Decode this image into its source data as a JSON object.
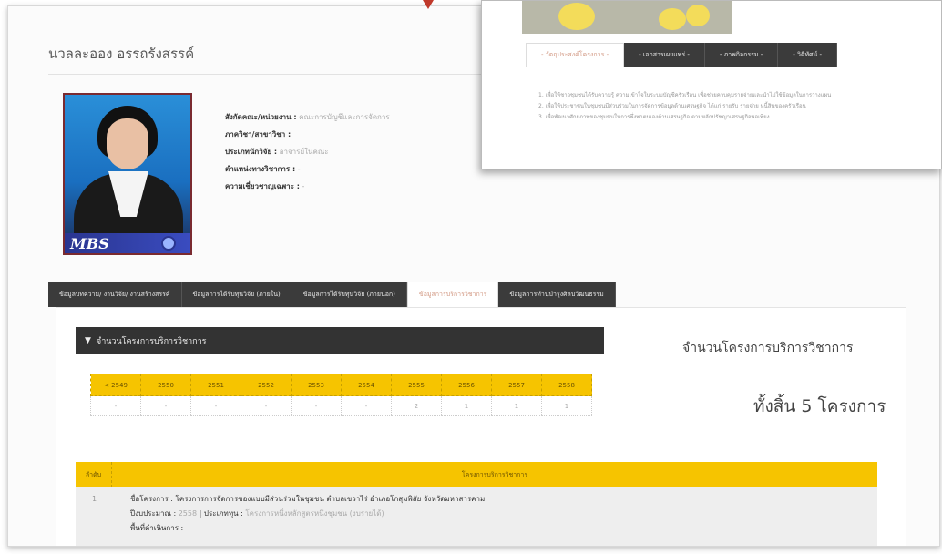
{
  "profile": {
    "name": "นวลละออง อรรถรังสรรค์",
    "fields": [
      {
        "label": "สังกัดคณะ/หน่วยงาน :",
        "value": "คณะการบัญชีและการจัดการ"
      },
      {
        "label": "ภาควิชา/สาขาวิชา :",
        "value": ""
      },
      {
        "label": "ประเภทนักวิจัย :",
        "value": "อาจารย์ในคณะ"
      },
      {
        "label": "ตำแหน่งทางวิชาการ :",
        "value": "-"
      },
      {
        "label": "ความเชี่ยวชาญเฉพาะ :",
        "value": "-"
      }
    ],
    "photo_label": "MBS"
  },
  "tabs": [
    {
      "label": "ข้อมูลบทความ/ งานวิจัย/ งานสร้างสรรค์",
      "active": false
    },
    {
      "label": "ข้อมูลการได้รับทุนวิจัย (ภายใน)",
      "active": false
    },
    {
      "label": "ข้อมูลการได้รับทุนวิจัย (ภายนอก)",
      "active": false
    },
    {
      "label": "ข้อมูลการบริการวิชาการ",
      "active": true
    },
    {
      "label": "ข้อมูลการทำนุบำรุงศิลปวัฒนธรรม",
      "active": false
    }
  ],
  "count_section": {
    "header": "จำนวนโครงการบริการวิชาการ",
    "years": [
      "< 2549",
      "2550",
      "2551",
      "2552",
      "2553",
      "2554",
      "2555",
      "2556",
      "2557",
      "2558"
    ],
    "counts": [
      "-",
      "-",
      "-",
      "-",
      "-",
      "-",
      "2",
      "1",
      "1",
      "1"
    ]
  },
  "summary": {
    "title": "จำนวนโครงการบริการวิชาการ",
    "total": "ทั้งสิ้น 5 โครงการ"
  },
  "projects": {
    "col_no": "ลำดับ",
    "col_name": "โครงการบริการวิชาการ",
    "rows": [
      {
        "no": "1",
        "name_label": "ชื่อโครงการ :",
        "name": "โครงการการจัดการของแบบมีส่วนร่วมในชุมชน ตำบลเขวาไร่ อำเภอโกสุมพิสัย จังหวัดมหาสารคาม",
        "budget_label": "ปีงบประมาณ :",
        "budget": "2558",
        "fund_label": "ประเภททุน :",
        "fund": "โครงการหนึ่งหลักสูตรหนึ่งชุมชน (งบรายได้)",
        "area_label": "พื้นที่ดำเนินการ :",
        "area": ""
      }
    ]
  },
  "popup": {
    "tabs": [
      {
        "label": "- วัตถุประสงค์โครงการ -",
        "active": true
      },
      {
        "label": "- เอกสารเผยแพร่ -",
        "active": false
      },
      {
        "label": "- ภาพกิจกรรม -",
        "active": false
      },
      {
        "label": "- วิดีทัศน์ -",
        "active": false
      }
    ],
    "items": [
      "1. เพื่อให้ชาวชุมชนได้รับความรู้ ความเข้าใจในระบบบัญชีครัวเรือน เพื่อช่วยควบคุมรายจ่ายและนำไปใช้ข้อมูลในการวางแผน",
      "2. เพื่อให้ประชาชนในชุมชนมีส่วนร่วมในการจัดการข้อมูลด้านเศรษฐกิจ ได้แก่ รายรับ รายจ่าย หนี้สินของครัวเรือน",
      "3. เพื่อพัฒนาศักยภาพของชุมชนในการพึ่งพาตนเองด้านเศรษฐกิจ ตามหลักปรัชญาเศรษฐกิจพอเพียง"
    ]
  },
  "colors": {
    "accent_yellow": "#f6c400",
    "tab_dark": "#3b3b3b",
    "active_tab_text": "#d39b86"
  }
}
